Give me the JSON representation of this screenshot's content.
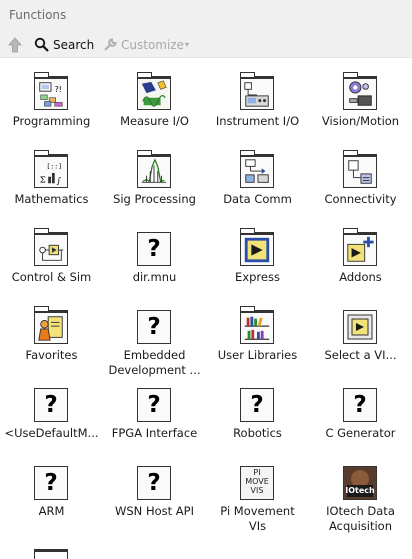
{
  "window": {
    "title": "Functions"
  },
  "toolbar": {
    "up_icon": "up-arrow-icon",
    "search_label": "Search",
    "customize_label": "Customize",
    "customize_arrow": "▾"
  },
  "palette": [
    {
      "name": "programming",
      "label": "Programming",
      "icon": "programming-icon",
      "kind": "folder"
    },
    {
      "name": "measure-io",
      "label": "Measure I/O",
      "icon": "measure-io-icon",
      "kind": "folder"
    },
    {
      "name": "instrument-io",
      "label": "Instrument I/O",
      "icon": "instrument-io-icon",
      "kind": "folder"
    },
    {
      "name": "vision-motion",
      "label": "Vision/Motion",
      "icon": "vision-motion-icon",
      "kind": "folder"
    },
    {
      "name": "mathematics",
      "label": "Mathematics",
      "icon": "mathematics-icon",
      "kind": "folder"
    },
    {
      "name": "sig-processing",
      "label": "Sig Processing",
      "icon": "sig-processing-icon",
      "kind": "folder"
    },
    {
      "name": "data-comm",
      "label": "Data Comm",
      "icon": "data-comm-icon",
      "kind": "folder"
    },
    {
      "name": "connectivity",
      "label": "Connectivity",
      "icon": "connectivity-icon",
      "kind": "folder"
    },
    {
      "name": "control-sim",
      "label": "Control & Sim",
      "icon": "control-sim-icon",
      "kind": "folder"
    },
    {
      "name": "dir-mnu",
      "label": "dir.mnu",
      "icon": "question-icon",
      "kind": "unknown"
    },
    {
      "name": "express",
      "label": "Express",
      "icon": "express-icon",
      "kind": "folder"
    },
    {
      "name": "addons",
      "label": "Addons",
      "icon": "addons-icon",
      "kind": "folder"
    },
    {
      "name": "favorites",
      "label": "Favorites",
      "icon": "favorites-icon",
      "kind": "folder"
    },
    {
      "name": "embedded-development",
      "label": "Embedded",
      "label2": "Development ...",
      "icon": "question-icon",
      "kind": "unknown"
    },
    {
      "name": "user-libraries",
      "label": "User Libraries",
      "icon": "user-libraries-icon",
      "kind": "folder"
    },
    {
      "name": "select-a-vi",
      "label": "Select a VI...",
      "icon": "select-vi-icon",
      "kind": "plain"
    },
    {
      "name": "use-default-menu",
      "label": "<UseDefaultM...",
      "icon": "question-icon",
      "kind": "unknown"
    },
    {
      "name": "fpga-interface",
      "label": "FPGA Interface",
      "icon": "question-icon",
      "kind": "unknown"
    },
    {
      "name": "robotics",
      "label": "Robotics",
      "icon": "question-icon",
      "kind": "unknown"
    },
    {
      "name": "c-generator",
      "label": "C Generator",
      "icon": "question-icon",
      "kind": "unknown"
    },
    {
      "name": "arm",
      "label": "ARM",
      "icon": "question-icon",
      "kind": "unknown"
    },
    {
      "name": "wsn-host-api",
      "label": "WSN Host API",
      "icon": "question-icon",
      "kind": "unknown"
    },
    {
      "name": "pi-movement-vis",
      "label": "Pi Movement",
      "label2": "VIs",
      "icon": "pi-move-vis-icon",
      "kind": "plain",
      "icon_text": [
        "PI",
        "MOVE",
        "VIS"
      ]
    },
    {
      "name": "iotech-data-acquisition",
      "label": "IOtech Data",
      "label2": "Acquisition",
      "icon": "iotech-icon",
      "kind": "plain",
      "icon_text": [
        "IOtech"
      ]
    }
  ],
  "colors": {
    "titlebar_bg": "#f0f0f0",
    "disabled_text": "#a8a8a8",
    "icon_yellow": "#f2e27a",
    "icon_blue": "#2a4fa8"
  }
}
